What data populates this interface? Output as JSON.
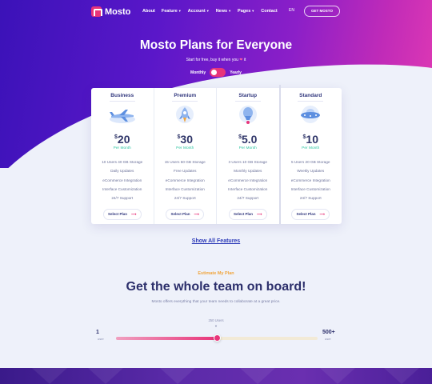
{
  "brand": {
    "name": "Mosto",
    "accent": "#e8357a"
  },
  "nav": {
    "items": [
      {
        "label": "About",
        "has_caret": false
      },
      {
        "label": "Feature",
        "has_caret": true
      },
      {
        "label": "Account",
        "has_caret": true
      },
      {
        "label": "News",
        "has_caret": true
      },
      {
        "label": "Pages",
        "has_caret": true
      },
      {
        "label": "Contact",
        "has_caret": false
      }
    ],
    "language": "EN",
    "cta": "GET MOSTO"
  },
  "hero": {
    "title": "Mosto Plans for Everyone",
    "subtitle": "Start for free, buy it when you",
    "subtitle_heart": "❤",
    "subtitle_end": "it",
    "toggle_left": "Monthly",
    "toggle_right": "Yearly"
  },
  "plans": [
    {
      "name": "Business",
      "icon": "airplane-icon",
      "currency": "$",
      "price": "20",
      "period": "Per Month",
      "features": [
        "10 Users 40 GB Storage",
        "Daily Updates",
        "eCommerce Integration",
        "Interface Customization",
        "24/7 Support"
      ],
      "button": "Select Plan"
    },
    {
      "name": "Premium",
      "icon": "rocket-icon",
      "currency": "$",
      "price": "30",
      "period": "Per Month",
      "features": [
        "15 Users 60 GB Storage",
        "Free Updates",
        "eCommerce Integration",
        "Interface Customization",
        "24/7 Support"
      ],
      "button": "Select Plan"
    },
    {
      "name": "Startup",
      "icon": "hot-air-balloon-icon",
      "currency": "$",
      "price": "5.0",
      "period": "Per Month",
      "features": [
        "3 Users 10 GB Storage",
        "Monthly Updates",
        "eCommerce Integration",
        "Interface Customization",
        "24/7 Support"
      ],
      "button": "Select Plan"
    },
    {
      "name": "Standard",
      "icon": "ufo-icon",
      "currency": "$",
      "price": "10",
      "period": "Per Month",
      "features": [
        "5 Users 20 GB Storage",
        "Weekly Updates",
        "eCommerce Integration",
        "Interface Customization",
        "24/7 Support"
      ],
      "button": "Select Plan"
    }
  ],
  "show_all": "Show All Features",
  "estimate": {
    "kicker": "Estimate My Plan",
    "title": "Get the whole team on board!",
    "description": "Mosto offers everything that your team needs to collaborate at a great price.",
    "slider_caption": "250 Users",
    "min": "1",
    "min_unit": "user",
    "max": "500+",
    "max_unit": "user",
    "slider_fraction": 0.5
  }
}
